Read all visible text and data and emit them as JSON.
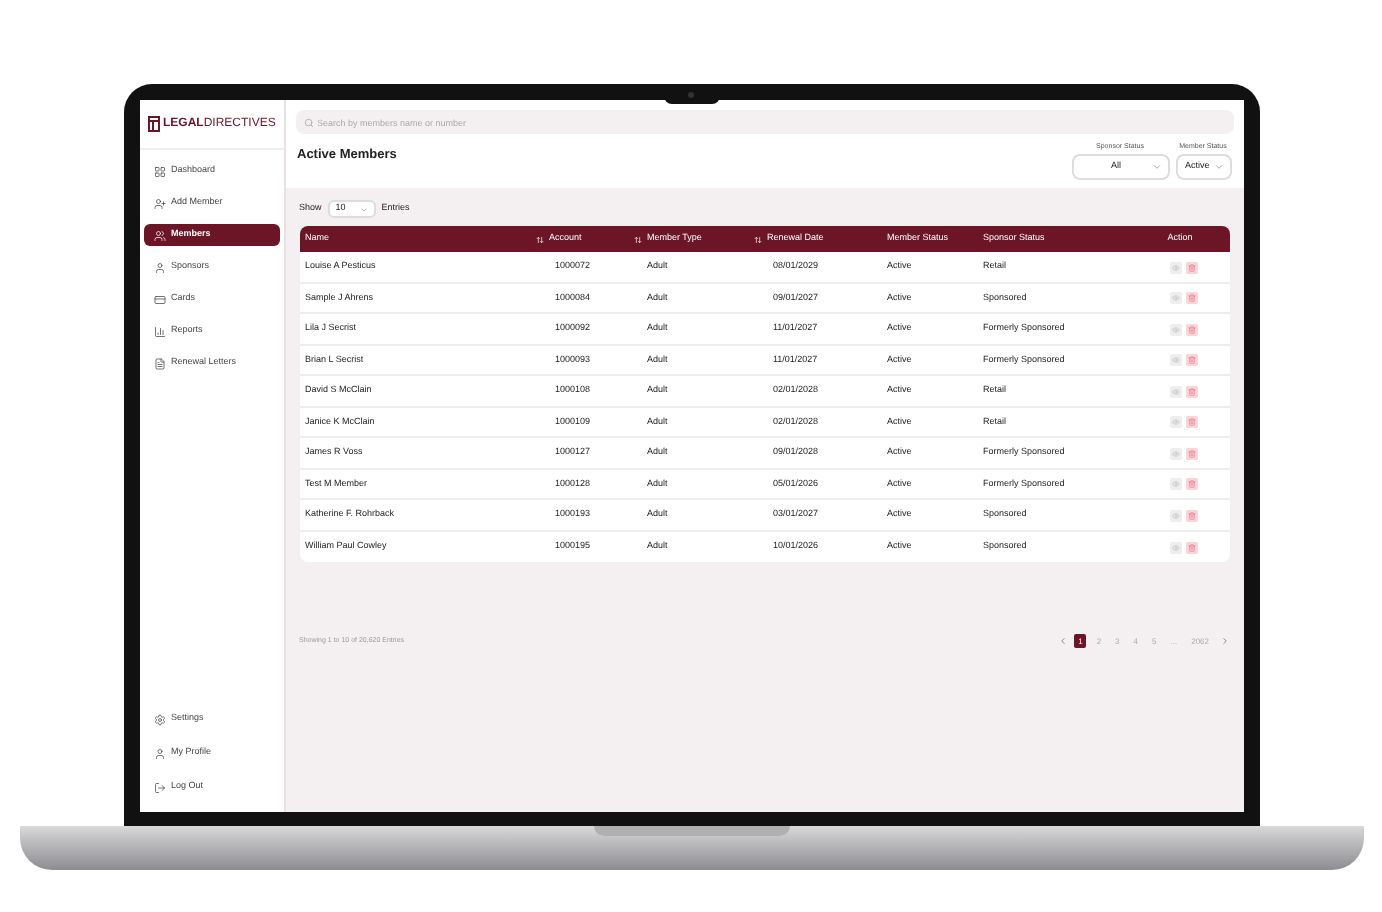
{
  "brand": {
    "first": "LEGAL",
    "second": "DIRECTIVES"
  },
  "sidebar": {
    "items": [
      {
        "label": "Dashboard",
        "selected": false
      },
      {
        "label": "Add Member",
        "selected": false
      },
      {
        "label": "Members",
        "selected": true
      },
      {
        "label": "Sponsors",
        "selected": false
      },
      {
        "label": "Cards",
        "selected": false
      },
      {
        "label": "Reports",
        "selected": false
      },
      {
        "label": "Renewal Letters",
        "selected": false
      }
    ],
    "bottom_items": [
      {
        "label": "Settings"
      },
      {
        "label": "My Profile"
      },
      {
        "label": "Log Out"
      }
    ]
  },
  "search": {
    "placeholder": "Search by members name or number"
  },
  "page_title": "Active Members",
  "filters": [
    {
      "label": "Sponsor Status",
      "value": "All"
    },
    {
      "label": "Member Status",
      "value": "Active"
    }
  ],
  "show": {
    "before": "Show",
    "value": "10",
    "after": "Entries"
  },
  "table": {
    "columns": [
      {
        "label": "Name",
        "sortable": true
      },
      {
        "label": "Account",
        "sortable": true
      },
      {
        "label": "Member Type",
        "sortable": true
      },
      {
        "label": "Renewal Date",
        "sortable": false
      },
      {
        "label": "Member Status",
        "sortable": false
      },
      {
        "label": "Sponsor Status",
        "sortable": false
      },
      {
        "label": "Action",
        "sortable": false
      }
    ],
    "rows": [
      [
        "Louise A Pesticus",
        "1000072",
        "Adult",
        "08/01/2029",
        "Active",
        "Retail"
      ],
      [
        "Sample J Ahrens",
        "1000084",
        "Adult",
        "09/01/2027",
        "Active",
        "Sponsored"
      ],
      [
        "Lila J Secrist",
        "1000092",
        "Adult",
        "11/01/2027",
        "Active",
        "Formerly Sponsored"
      ],
      [
        "Brian L Secrist",
        "1000093",
        "Adult",
        "11/01/2027",
        "Active",
        "Formerly Sponsored"
      ],
      [
        "David S McClain",
        "1000108",
        "Adult",
        "02/01/2028",
        "Active",
        "Retail"
      ],
      [
        "Janice K McClain",
        "1000109",
        "Adult",
        "02/01/2028",
        "Active",
        "Retail"
      ],
      [
        "James R Voss",
        "1000127",
        "Adult",
        "09/01/2028",
        "Active",
        "Formerly Sponsored"
      ],
      [
        "Test M Member",
        "1000128",
        "Adult",
        "05/01/2026",
        "Active",
        "Formerly Sponsored"
      ],
      [
        "Katherine F. Rohrback",
        "1000193",
        "Adult",
        "03/01/2027",
        "Active",
        "Sponsored"
      ],
      [
        "William Paul Cowley",
        "1000195",
        "Adult",
        "10/01/2026",
        "Active",
        "Sponsored"
      ]
    ]
  },
  "footer": {
    "summary": "Showing 1 to 10 of 20,620 Entries",
    "pages": [
      {
        "label": "1",
        "selected": true
      },
      {
        "label": "2",
        "selected": false
      },
      {
        "label": "3",
        "selected": false
      },
      {
        "label": "4",
        "selected": false
      },
      {
        "label": "5",
        "selected": false
      },
      {
        "label": "...",
        "selected": false
      },
      {
        "label": "2062",
        "selected": false
      }
    ]
  }
}
